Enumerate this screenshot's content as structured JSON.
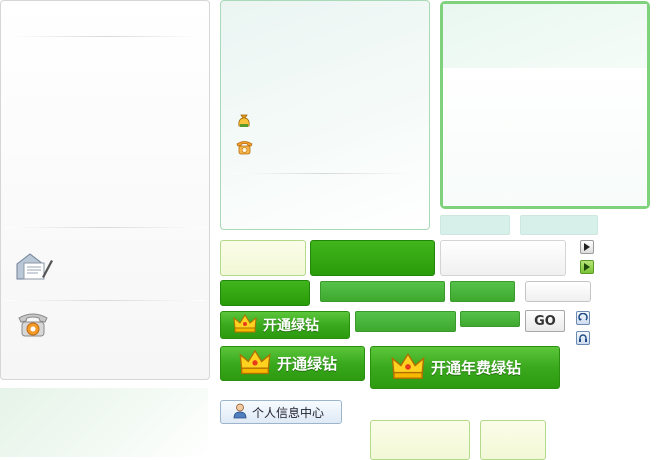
{
  "vip_buttons": {
    "small_label": "开通绿钻",
    "medium_label": "开通绿钻",
    "large_label": "开通年费绿钻"
  },
  "go_button": {
    "label": "GO"
  },
  "profile_button": {
    "label": "个人信息中心"
  },
  "icons": {
    "left_panel": [
      "mail-icon",
      "phone-icon"
    ],
    "center_panel": [
      "money-bag-icon",
      "phone-icon"
    ],
    "controls": [
      "play-gray-icon",
      "play-green-icon",
      "refresh-icon",
      "headphones-icon"
    ]
  },
  "colors": {
    "brand_green": "#2fa112",
    "light_green_border": "#7fd27b",
    "pale_teal": "#d8f0ea",
    "cream": "#f5f9dc"
  }
}
